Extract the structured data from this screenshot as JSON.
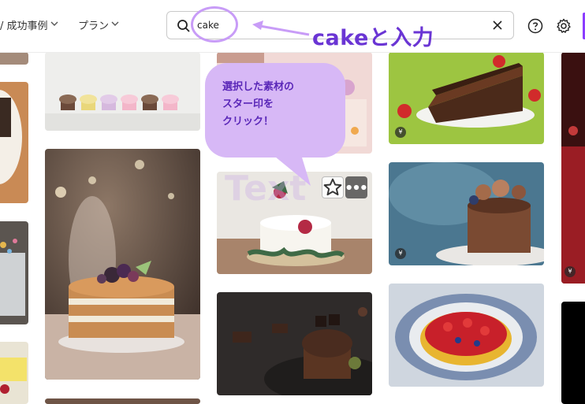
{
  "header": {
    "nav_case_label": "/ 成功事例",
    "nav_plan_label": "プラン",
    "chevron": "⌄"
  },
  "search": {
    "value": "cake",
    "placeholder": ""
  },
  "annotation": {
    "title": "cakeと入力",
    "callout_lines": [
      "選択した素材の",
      "スター印を",
      "クリック！"
    ]
  },
  "tiles": {
    "badge_symbol": "¥"
  },
  "colors": {
    "accent": "#8b3dff",
    "annotation_purple": "#6a35d4",
    "callout_bg": "#d7b8f6",
    "ring": "#c89cf7"
  },
  "icons": [
    "search-icon",
    "clear-icon",
    "help-icon",
    "gear-icon",
    "star-icon",
    "more-icon",
    "chevron-down-icon"
  ]
}
